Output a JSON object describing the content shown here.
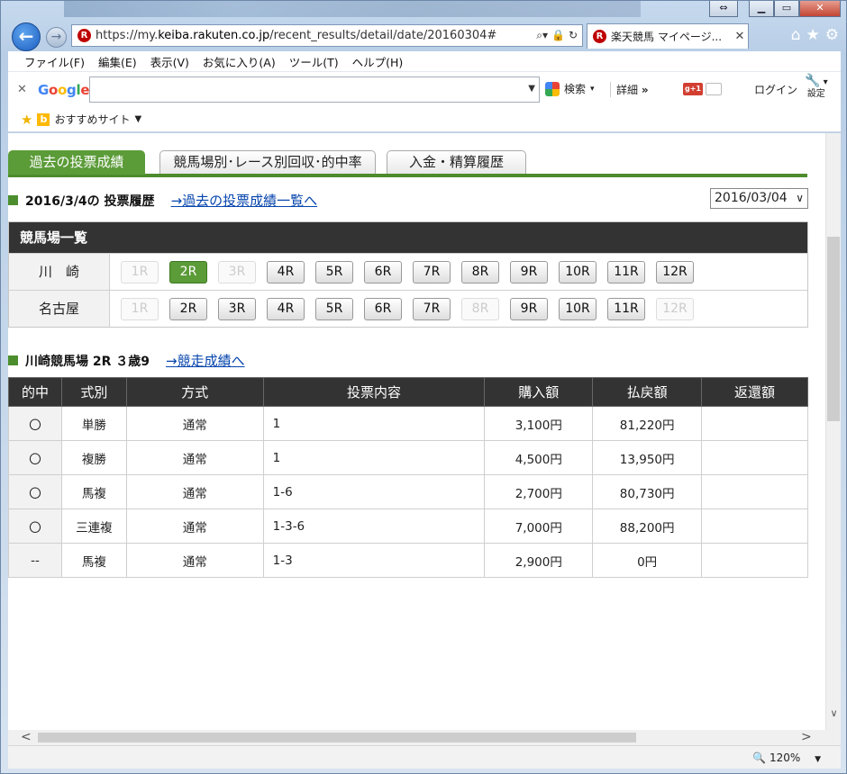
{
  "browser": {
    "url_prefix": "https://my.",
    "url_domain": "keiba.rakuten.co.jp",
    "url_path": "/recent_results/detail/date/20160304#",
    "tab_title": "楽天競馬 マイページ...",
    "menu": [
      "ファイル(F)",
      "編集(E)",
      "表示(V)",
      "お気に入り(A)",
      "ツール(T)",
      "ヘルプ(H)"
    ],
    "google_logo": "Google",
    "search_label": "検索",
    "detail_label": "詳細",
    "login_label": "ログイン",
    "settings_label": "設定",
    "favorites_label": "おすすめサイト",
    "zoom": "120%"
  },
  "page": {
    "tabs": [
      "過去の投票成績",
      "競馬場別･レース別回収･的中率",
      "入金・精算履歴"
    ],
    "history_title": "2016/3/4の 投票履歴",
    "history_link": "→過去の投票成績一覧へ",
    "date_select": "2016/03/04",
    "venue_header": "競馬場一覧",
    "venues": [
      {
        "name": "川　崎",
        "races": [
          {
            "label": "1R",
            "state": "disabled"
          },
          {
            "label": "2R",
            "state": "selected"
          },
          {
            "label": "3R",
            "state": "disabled"
          },
          {
            "label": "4R",
            "state": "normal"
          },
          {
            "label": "5R",
            "state": "normal"
          },
          {
            "label": "6R",
            "state": "normal"
          },
          {
            "label": "7R",
            "state": "normal"
          },
          {
            "label": "8R",
            "state": "normal"
          },
          {
            "label": "9R",
            "state": "normal"
          },
          {
            "label": "10R",
            "state": "normal"
          },
          {
            "label": "11R",
            "state": "normal"
          },
          {
            "label": "12R",
            "state": "normal"
          }
        ]
      },
      {
        "name": "名古屋",
        "races": [
          {
            "label": "1R",
            "state": "disabled"
          },
          {
            "label": "2R",
            "state": "normal"
          },
          {
            "label": "3R",
            "state": "normal"
          },
          {
            "label": "4R",
            "state": "normal"
          },
          {
            "label": "5R",
            "state": "normal"
          },
          {
            "label": "6R",
            "state": "normal"
          },
          {
            "label": "7R",
            "state": "normal"
          },
          {
            "label": "8R",
            "state": "disabled"
          },
          {
            "label": "9R",
            "state": "normal"
          },
          {
            "label": "10R",
            "state": "normal"
          },
          {
            "label": "11R",
            "state": "normal"
          },
          {
            "label": "12R",
            "state": "disabled"
          }
        ]
      }
    ],
    "race_title": "川崎競馬場 2R ３歳9",
    "race_link": "→競走成績へ",
    "table_headers": [
      "的中",
      "式別",
      "方式",
      "投票内容",
      "購入額",
      "払戻額",
      "返還額"
    ],
    "rows": [
      [
        "〇",
        "単勝",
        "通常",
        "1",
        "3,100円",
        "81,220円",
        ""
      ],
      [
        "〇",
        "複勝",
        "通常",
        "1",
        "4,500円",
        "13,950円",
        ""
      ],
      [
        "〇",
        "馬複",
        "通常",
        "1-6",
        "2,700円",
        "80,730円",
        ""
      ],
      [
        "〇",
        "三連複",
        "通常",
        "1-3-6",
        "7,000円",
        "88,200円",
        ""
      ],
      [
        "--",
        "馬複",
        "通常",
        "1-3",
        "2,900円",
        "0円",
        ""
      ]
    ]
  }
}
